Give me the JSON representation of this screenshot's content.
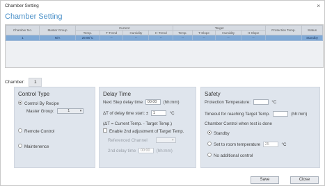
{
  "window": {
    "title": "Chamber Setting",
    "close_glyph": "×"
  },
  "heading": "Chamber Setting",
  "table": {
    "group_headers": {
      "current": "Current",
      "target": "Target"
    },
    "columns": {
      "chamber_no": "Chamber No.",
      "master_group": "Master Group",
      "current": [
        "Temp.",
        "T-Trend",
        "Humidity",
        "H-Trend"
      ],
      "target": [
        "Temp.",
        "T-Slope",
        "Humidity",
        "H-Slope"
      ],
      "protection_temp": "Protection Temp.",
      "status": "Status"
    },
    "rows": [
      [
        "1",
        "N/A",
        "29.96°C",
        "--",
        "--",
        "--",
        "--",
        "--",
        "--",
        "--",
        "",
        "Standby"
      ]
    ]
  },
  "chamber": {
    "label": "Chamber:",
    "value": "1"
  },
  "control_type": {
    "title": "Control Type",
    "options": [
      "Control By Recipe",
      "Remote Control",
      "Maintenence"
    ],
    "selected_index": 0,
    "master_group_label": "Master Group:",
    "master_group_value": "1"
  },
  "delay_time": {
    "title": "Delay Time",
    "next_step_label": "Next Step delay time",
    "next_step_value": "00:00",
    "next_step_unit": "(hh:mm)",
    "delta_label": "ΔT of delay time start: ±",
    "delta_value": "1",
    "delta_unit": "°C",
    "formula": "(ΔT = Current Temp. - Target Temp.)",
    "enable_label": "Enable 2nd adjustment of Target Temp.",
    "ref_channel_label": "Referenced Channel",
    "second_delay_label": "2nd delay time",
    "second_delay_value": "00:00",
    "second_delay_unit": "(hh:mm)"
  },
  "safety": {
    "title": "Safety",
    "protection_label": "Protection Temperature:",
    "protection_value": "",
    "protection_unit": "°C",
    "timeout_label": "Timeout for reaching Target Temp.",
    "timeout_value": "",
    "timeout_unit": "(hh:mm)",
    "control_label": "Chamber Control when test is done",
    "options": [
      "Standby",
      "Set to room temperature",
      "No additional control"
    ],
    "selected_index": 0,
    "room_temp_value": "25",
    "room_temp_unit": "°C"
  },
  "buttons": {
    "save": "Save",
    "close": "Close"
  }
}
